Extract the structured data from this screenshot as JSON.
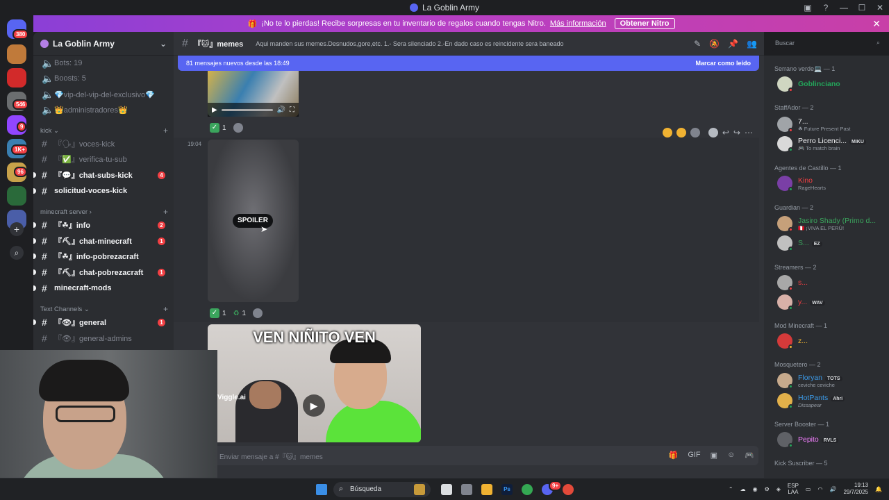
{
  "window": {
    "title": "La Goblin Army",
    "controls": [
      "—",
      "☐",
      "✕"
    ]
  },
  "rail": {
    "badges": [
      "380",
      "546",
      "9",
      "1K+",
      "96"
    ],
    "add_icon": "+",
    "explore_icon": "⌕"
  },
  "nitro_banner": {
    "text": "¡No te lo pierdas! Recibe sorpresas en tu inventario de regalos cuando tengas Nitro.",
    "link": "Más información",
    "button": "Obtener Nitro",
    "close": "✕"
  },
  "server": {
    "name": "La Goblin Army",
    "chevron": "⌄"
  },
  "channels": {
    "voice_top": [
      {
        "label": "Bots: 19"
      },
      {
        "label": "Boosts: 5"
      },
      {
        "label": "💎vip-del-vip-del-exclusivo💎"
      },
      {
        "label": "👑administradores👑"
      }
    ],
    "cat_kick": "kick ⌄",
    "kick": [
      {
        "label": "『🗣』voces-kick",
        "unread": false,
        "count": ""
      },
      {
        "label": "『✅』verifica-tu-sub",
        "unread": false,
        "count": ""
      },
      {
        "label": "『💬』chat-subs-kick",
        "unread": true,
        "count": "4"
      },
      {
        "label": "solicitud-voces-kick",
        "unread": true,
        "count": ""
      }
    ],
    "cat_minecraft": "minecraft server ›",
    "minecraft": [
      {
        "label": "『☘』info",
        "unread": true,
        "count": "2"
      },
      {
        "label": "『⛏』chat-minecraft",
        "unread": true,
        "count": "1"
      },
      {
        "label": "『☘』info-pobrezacraft",
        "unread": true,
        "count": ""
      },
      {
        "label": "『⛏』chat-pobrezacraft",
        "unread": true,
        "count": "1"
      },
      {
        "label": "minecraft-mods",
        "unread": true,
        "count": ""
      }
    ],
    "cat_text": "Text Channels ⌄",
    "text": [
      {
        "label": "『👁』general",
        "unread": true,
        "count": "1"
      },
      {
        "label": "『👁』general-admins",
        "unread": false,
        "count": ""
      }
    ],
    "plus": "+"
  },
  "header": {
    "channel": "『🐱』memes",
    "topic": "Aqui manden sus memes.Desnudos,gore,etc. 1.- Sera silenciado 2.-En dado caso es reincidente sera baneado",
    "icons": [
      "✎",
      "🔕",
      "📌",
      "👥"
    ]
  },
  "search": {
    "placeholder": "Buscar",
    "icon": "⌕"
  },
  "messages": {
    "new_bar": "81 mensajes nuevos desde las 18:49",
    "mark_read": "Marcar como leído",
    "timestamp": "19:04",
    "spoiler_label": "SPOILER",
    "reaction1": {
      "count": "1"
    },
    "reaction2": {
      "count_a": "1",
      "count_b": "1"
    },
    "video_title": "VEN NIÑITO VEN",
    "watermark": "Viggle.ai",
    "hover_actions": [
      "↩",
      "↪",
      "⋯"
    ]
  },
  "composer": {
    "placeholder": "Enviar mensaje a #『🐱』memes",
    "tools": [
      "🎁",
      "GIF",
      "▣",
      "☺",
      "🎮"
    ]
  },
  "members": {
    "groups": [
      {
        "title": "Serrano verde💻 — 1",
        "items": [
          {
            "name": "Goblinciano",
            "sub": "",
            "tag": "",
            "color": "#23a55a"
          }
        ]
      },
      {
        "title": "StaffAdor — 2",
        "items": [
          {
            "name": "7...",
            "sub": "☘ Future Present Past",
            "tag": "",
            "color": "#f2f3f5"
          },
          {
            "name": "Perro Licenci...",
            "sub": "🎮 To match brain",
            "tag": "MIKU",
            "color": "#f2f3f5"
          }
        ]
      },
      {
        "title": "Agentes de Castillo — 1",
        "items": [
          {
            "name": "Kino",
            "sub": "RageHearts",
            "tag": "",
            "color": "#f23f43"
          }
        ]
      },
      {
        "title": "Guardian — 2",
        "items": [
          {
            "name": "Jasiro Shady (Primo d...",
            "sub": "🇵🇪 ¡VIVA EL PERÚ!",
            "tag": "",
            "color": "#3ba55d"
          },
          {
            "name": "S...",
            "sub": "",
            "tag": "EZ",
            "color": "#3ba55d"
          }
        ]
      },
      {
        "title": "Streamers — 2",
        "items": [
          {
            "name": "s...",
            "sub": "",
            "tag": "",
            "color": "#f23f43"
          },
          {
            "name": "y...",
            "sub": "",
            "tag": "WAV",
            "color": "#f23f43"
          }
        ]
      },
      {
        "title": "Mod Minecraft — 1",
        "items": [
          {
            "name": "z...",
            "sub": "",
            "tag": "",
            "color": "#f0b232"
          }
        ]
      },
      {
        "title": "Mosquetero — 2",
        "items": [
          {
            "name": "Floryan",
            "sub": "ceviche ceviche",
            "tag": "TOTS",
            "color": "#3b9ae8"
          },
          {
            "name": "HotPants",
            "sub": "Dissapear",
            "tag": "Ahri",
            "color": "#3b9ae8"
          }
        ]
      },
      {
        "title": "Server Booster — 1",
        "items": [
          {
            "name": "Pepito",
            "sub": "",
            "tag": "RVLS",
            "color": "#f47fff"
          }
        ]
      },
      {
        "title": "Kick Suscriber — 5",
        "items": []
      }
    ]
  },
  "taskbar": {
    "search": "Búsqueda",
    "lang_top": "ESP",
    "lang_bottom": "LAA",
    "time": "19:13",
    "date": "29/7/2025",
    "discord_badge": "9+"
  }
}
